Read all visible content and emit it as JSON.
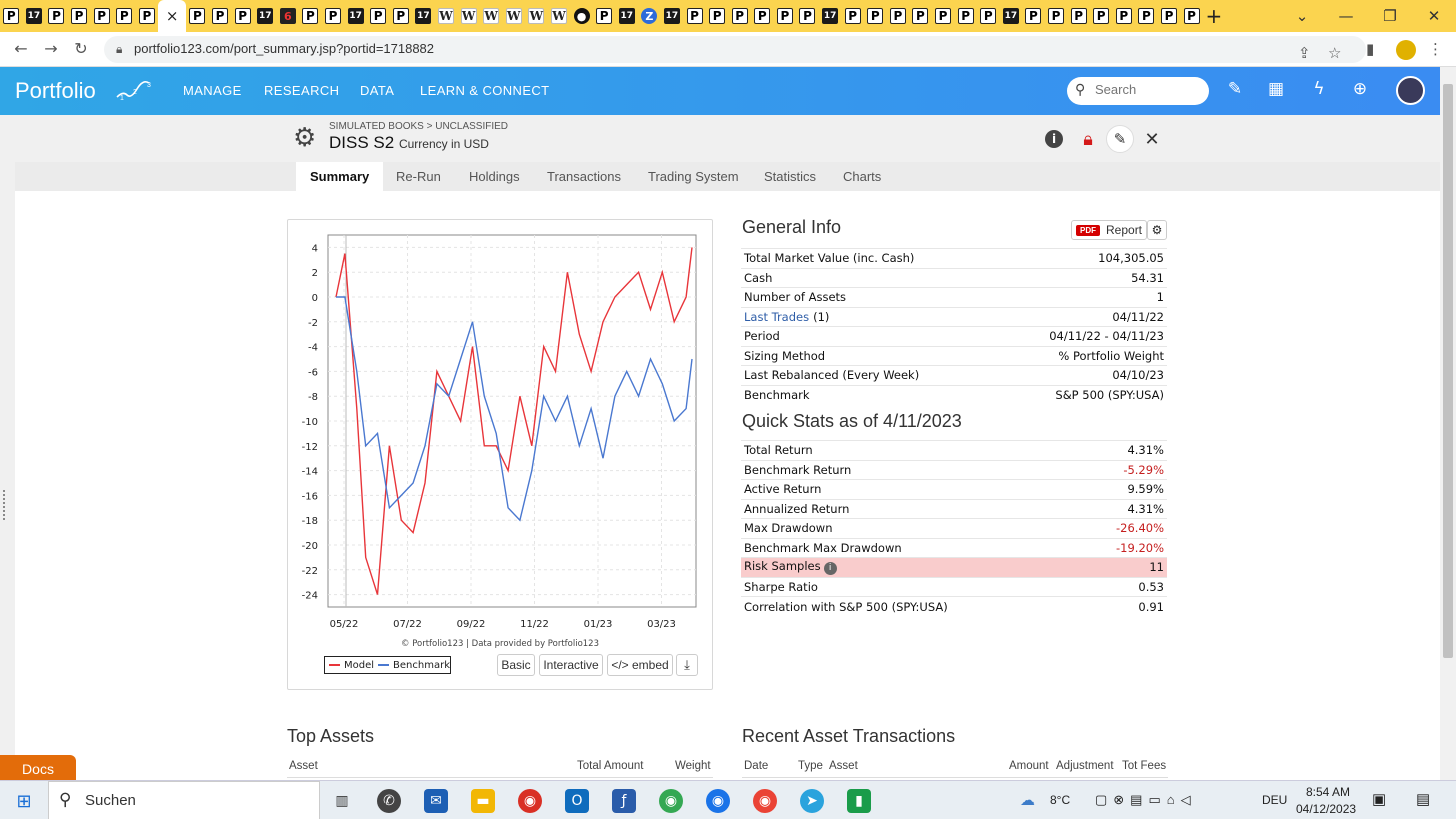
{
  "browser": {
    "tabs": [
      "P",
      "17",
      "P",
      "P",
      "P",
      "P",
      "P",
      "×",
      "P",
      "P",
      "P",
      "17",
      "6",
      "P",
      "P",
      "17",
      "P",
      "P",
      "17",
      "W",
      "W",
      "W",
      "W",
      "W",
      "W",
      "●",
      "P",
      "17",
      "Z",
      "17",
      "P",
      "P",
      "P",
      "P",
      "P",
      "P",
      "17",
      "P",
      "P",
      "P",
      "P",
      "P",
      "P",
      "P",
      "17",
      "P",
      "P",
      "P",
      "P",
      "P",
      "P",
      "P",
      "P"
    ],
    "new_tab": "+",
    "url": "portfolio123.com/port_summary.jsp?portid=1718882"
  },
  "app": {
    "logo": "Portfolio",
    "nav": [
      "MANAGE",
      "RESEARCH",
      "DATA",
      "LEARN & CONNECT"
    ],
    "search_placeholder": "Search"
  },
  "portfolio": {
    "breadcrumb": "SIMULATED BOOKS > UNCLASSIFIED",
    "name": "DISS S2",
    "currency": "Currency in USD",
    "tabs": [
      "Summary",
      "Re-Run",
      "Holdings",
      "Transactions",
      "Trading System",
      "Statistics",
      "Charts"
    ]
  },
  "chart_data": {
    "type": "line",
    "x_ticks": [
      "05/22",
      "07/22",
      "09/22",
      "11/22",
      "01/23",
      "03/23"
    ],
    "y_ticks": [
      "4",
      "2",
      "0",
      "-2",
      "-4",
      "-6",
      "-8",
      "-10",
      "-12",
      "-14",
      "-16",
      "-18",
      "-20",
      "-22",
      "-24"
    ],
    "ylim": [
      -25,
      5
    ],
    "x_range": [
      "04/11/22",
      "04/11/23"
    ],
    "credit": "© Portfolio123 | Data provided by Portfolio123",
    "legend": [
      "Model",
      "Benchmark"
    ],
    "colors": {
      "Model": "#e8353a",
      "Benchmark": "#4a78d0"
    },
    "series": [
      {
        "name": "Model",
        "x_index": [
          0,
          0.3,
          0.7,
          1,
          1.4,
          1.8,
          2.2,
          2.6,
          3,
          3.4,
          3.8,
          4.2,
          4.6,
          5,
          5.4,
          5.8,
          6.2,
          6.6,
          7,
          7.4,
          7.8,
          8.2,
          8.6,
          9,
          9.4,
          9.8,
          10.2,
          10.6,
          11,
          11.4,
          11.8,
          12
        ],
        "values": [
          0,
          3.5,
          -9,
          -21,
          -24,
          -12,
          -18,
          -19,
          -15,
          -6,
          -8,
          -10,
          -4,
          -12,
          -12,
          -14,
          -8,
          -12,
          -4,
          -6,
          2,
          -3,
          -6,
          -2,
          0,
          1,
          2,
          -1,
          2,
          -2,
          0,
          4
        ]
      },
      {
        "name": "Benchmark",
        "x_index": [
          0,
          0.3,
          0.7,
          1,
          1.4,
          1.8,
          2.2,
          2.6,
          3,
          3.4,
          3.8,
          4.2,
          4.6,
          5,
          5.4,
          5.8,
          6.2,
          6.6,
          7,
          7.4,
          7.8,
          8.2,
          8.6,
          9,
          9.4,
          9.8,
          10.2,
          10.6,
          11,
          11.4,
          11.8,
          12
        ],
        "values": [
          0,
          0,
          -6,
          -12,
          -11,
          -17,
          -16,
          -15,
          -12,
          -7,
          -8,
          -5,
          -2,
          -8,
          -11,
          -17,
          -18,
          -14,
          -8,
          -10,
          -8,
          -12,
          -9,
          -13,
          -8,
          -6,
          -8,
          -5,
          -7,
          -10,
          -9,
          -5
        ]
      }
    ]
  },
  "chart_buttons": [
    "Basic",
    "Interactive",
    "</> embed"
  ],
  "general_info": {
    "title": "General Info",
    "report_label": "Report",
    "pdf_badge": "PDF",
    "rows": [
      {
        "label": "Total Market Value (inc. Cash)",
        "value": "104,305.05"
      },
      {
        "label": "Cash",
        "value": "54.31"
      },
      {
        "label": "Number of Assets",
        "value": "1"
      },
      {
        "label": "Last Trades",
        "label_suffix": "(1)",
        "value": "04/11/22"
      },
      {
        "label": "Period",
        "value": "04/11/22 - 04/11/23"
      },
      {
        "label": "Sizing Method",
        "value": "% Portfolio Weight"
      },
      {
        "label": "Last Rebalanced (Every Week)",
        "value": "04/10/23"
      },
      {
        "label": "Benchmark",
        "value": "S&P 500 (SPY:USA)"
      }
    ]
  },
  "quick_stats": {
    "title": "Quick Stats as of 4/11/2023",
    "rows": [
      {
        "label": "Total Return",
        "value": "4.31%"
      },
      {
        "label": "Benchmark Return",
        "value": "-5.29%"
      },
      {
        "label": "Active Return",
        "value": "9.59%"
      },
      {
        "label": "Annualized Return",
        "value": "4.31%"
      },
      {
        "label": "Max Drawdown",
        "value": "-26.40%"
      },
      {
        "label": "Benchmark Max Drawdown",
        "value": "-19.20%"
      },
      {
        "label": "Risk Samples",
        "value": "11"
      },
      {
        "label": "Sharpe Ratio",
        "value": "0.53"
      },
      {
        "label": "Correlation with S&P 500 (SPY:USA)",
        "value": "0.91"
      }
    ]
  },
  "top_assets": {
    "title": "Top Assets",
    "columns": [
      "Asset",
      "Total Amount",
      "Weight"
    ]
  },
  "recent_transactions": {
    "title": "Recent Asset Transactions",
    "columns": [
      "Date",
      "Type",
      "Asset",
      "Amount",
      "Adjustment",
      "Tot Fees"
    ]
  },
  "docs_label": "Docs",
  "taskbar": {
    "search_label": "Suchen",
    "temperature": "8°C",
    "language": "DEU",
    "time": "8:54 AM",
    "date": "04/12/2023"
  }
}
